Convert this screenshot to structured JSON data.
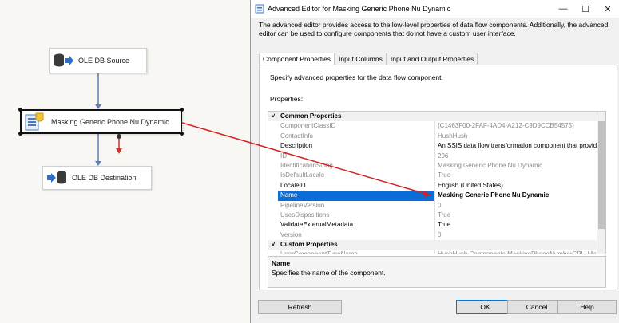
{
  "designer": {
    "source_label": "OLE DB Source",
    "transform_label": "Masking Generic Phone Nu Dynamic",
    "destination_label": "OLE DB Destination"
  },
  "dialog": {
    "title": "Advanced Editor for Masking Generic Phone Nu Dynamic",
    "description": "The advanced editor provides access to the low-level properties of data flow components. Additionally, the advanced editor can be used to configure components that do not have a custom user interface.",
    "tabs": [
      "Component Properties",
      "Input Columns",
      "Input and Output Properties"
    ],
    "specify_text": "Specify advanced properties for the data flow component.",
    "properties_label": "Properties:",
    "rows": [
      {
        "name": "Common Properties",
        "value": "",
        "kind": "cat"
      },
      {
        "name": "ComponentClassID",
        "value": "{C1463F00-2FAF-4AD4-A212-C9D9CCB54575}",
        "kind": "dim"
      },
      {
        "name": "ContactInfo",
        "value": "HushHush",
        "kind": "dim"
      },
      {
        "name": "Description",
        "value": "An SSIS data flow transformation component  that provides",
        "kind": "norm"
      },
      {
        "name": "ID",
        "value": "296",
        "kind": "dim"
      },
      {
        "name": "IdentificationString",
        "value": "Masking Generic Phone Nu Dynamic",
        "kind": "dim"
      },
      {
        "name": "IsDefaultLocale",
        "value": "True",
        "kind": "dim"
      },
      {
        "name": "LocaleID",
        "value": "English (United States)",
        "kind": "norm"
      },
      {
        "name": "Name",
        "value": "Masking Generic Phone Nu Dynamic",
        "kind": "sel"
      },
      {
        "name": "PipelineVersion",
        "value": "0",
        "kind": "dim"
      },
      {
        "name": "UsesDispositions",
        "value": "True",
        "kind": "dim"
      },
      {
        "name": "ValidateExternalMetadata",
        "value": "True",
        "kind": "norm"
      },
      {
        "name": "Version",
        "value": "0",
        "kind": "dim"
      },
      {
        "name": "Custom Properties",
        "value": "",
        "kind": "cat"
      },
      {
        "name": "UserComponentTypeName",
        "value": "HushHush.Components.MaskingPhoneNumberCPU.Mask",
        "kind": "dim"
      }
    ],
    "help_name": "Name",
    "help_desc": "Specifies the name of the component.",
    "buttons": {
      "refresh": "Refresh",
      "ok": "OK",
      "cancel": "Cancel",
      "help": "Help"
    }
  },
  "colors": {
    "selection": "#0a6dd6",
    "arrow": "#d42020",
    "flow": "#5a7fb0"
  }
}
